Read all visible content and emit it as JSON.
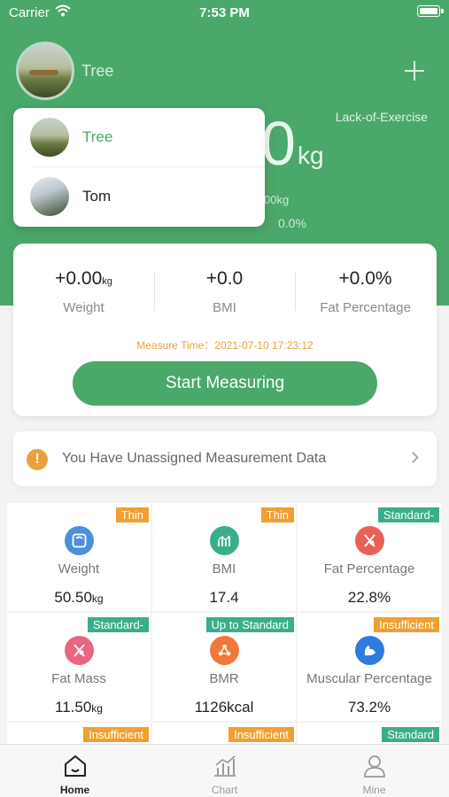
{
  "status_bar": {
    "carrier": "Carrier",
    "time": "7:53 PM"
  },
  "header": {
    "user_name": "Tree",
    "body_status": "Lack-of-Exercise",
    "weight_value_partial": "0",
    "weight_unit": "kg",
    "sub_value_partial": "00kg",
    "sub_percent_partial": "0.0%"
  },
  "user_dropdown": {
    "items": [
      {
        "name": "Tree",
        "active": true
      },
      {
        "name": "Tom",
        "active": false
      }
    ]
  },
  "measure_card": {
    "stats": [
      {
        "value": "+0.00",
        "unit": "kg",
        "label": "Weight"
      },
      {
        "value": "+0.0",
        "unit": "",
        "label": "BMI"
      },
      {
        "value": "+0.0%",
        "unit": "",
        "label": "Fat Percentage"
      }
    ],
    "measure_time": "Measure Time：2021-07-10 17:23:12",
    "start_button": "Start Measuring"
  },
  "notice": {
    "text": "You Have Unassigned Measurement Data"
  },
  "metrics": [
    {
      "label": "Weight",
      "value": "50.50",
      "unit": "kg",
      "tag": "Thin",
      "tag_color": "#f0a030",
      "icon": "scale-icon",
      "icon_color": "#4c8fdb"
    },
    {
      "label": "BMI",
      "value": "17.4",
      "unit": "",
      "tag": "Thin",
      "tag_color": "#f0a030",
      "icon": "bmi-chart-icon",
      "icon_color": "#3aae8a"
    },
    {
      "label": "Fat Percentage",
      "value": "22.8%",
      "unit": "",
      "tag": "Standard-",
      "tag_color": "#3aae8a",
      "icon": "body-fat-icon",
      "icon_color": "#e96058"
    },
    {
      "label": "Fat Mass",
      "value": "11.50",
      "unit": "kg",
      "tag": "Standard-",
      "tag_color": "#3aae8a",
      "icon": "fat-mass-icon",
      "icon_color": "#e8667f"
    },
    {
      "label": "BMR",
      "value": "1126kcal",
      "unit": "",
      "tag": "Up to Standard",
      "tag_color": "#3aae8a",
      "icon": "bmr-molecule-icon",
      "icon_color": "#f0783b"
    },
    {
      "label": "Muscular Percentage",
      "value": "73.2%",
      "unit": "",
      "tag": "Insufficient",
      "tag_color": "#f0a030",
      "icon": "muscle-icon",
      "icon_color": "#2e7be0"
    },
    {
      "label": "",
      "value": "",
      "unit": "",
      "tag": "Insufficient",
      "tag_color": "#f0a030",
      "icon": "",
      "icon_color": ""
    },
    {
      "label": "",
      "value": "",
      "unit": "",
      "tag": "Insufficient",
      "tag_color": "#f0a030",
      "icon": "",
      "icon_color": ""
    },
    {
      "label": "",
      "value": "",
      "unit": "",
      "tag": "Standard",
      "tag_color": "#3aae8a",
      "icon": "",
      "icon_color": ""
    }
  ],
  "tab_bar": {
    "tabs": [
      {
        "label": "Home",
        "icon": "home-icon",
        "active": true
      },
      {
        "label": "Chart",
        "icon": "chart-icon",
        "active": false
      },
      {
        "label": "Mine",
        "icon": "person-icon",
        "active": false
      }
    ]
  },
  "colors": {
    "brand_green": "#4aa86a",
    "warning_orange": "#e9a23b",
    "time_orange": "#e5a33d"
  }
}
